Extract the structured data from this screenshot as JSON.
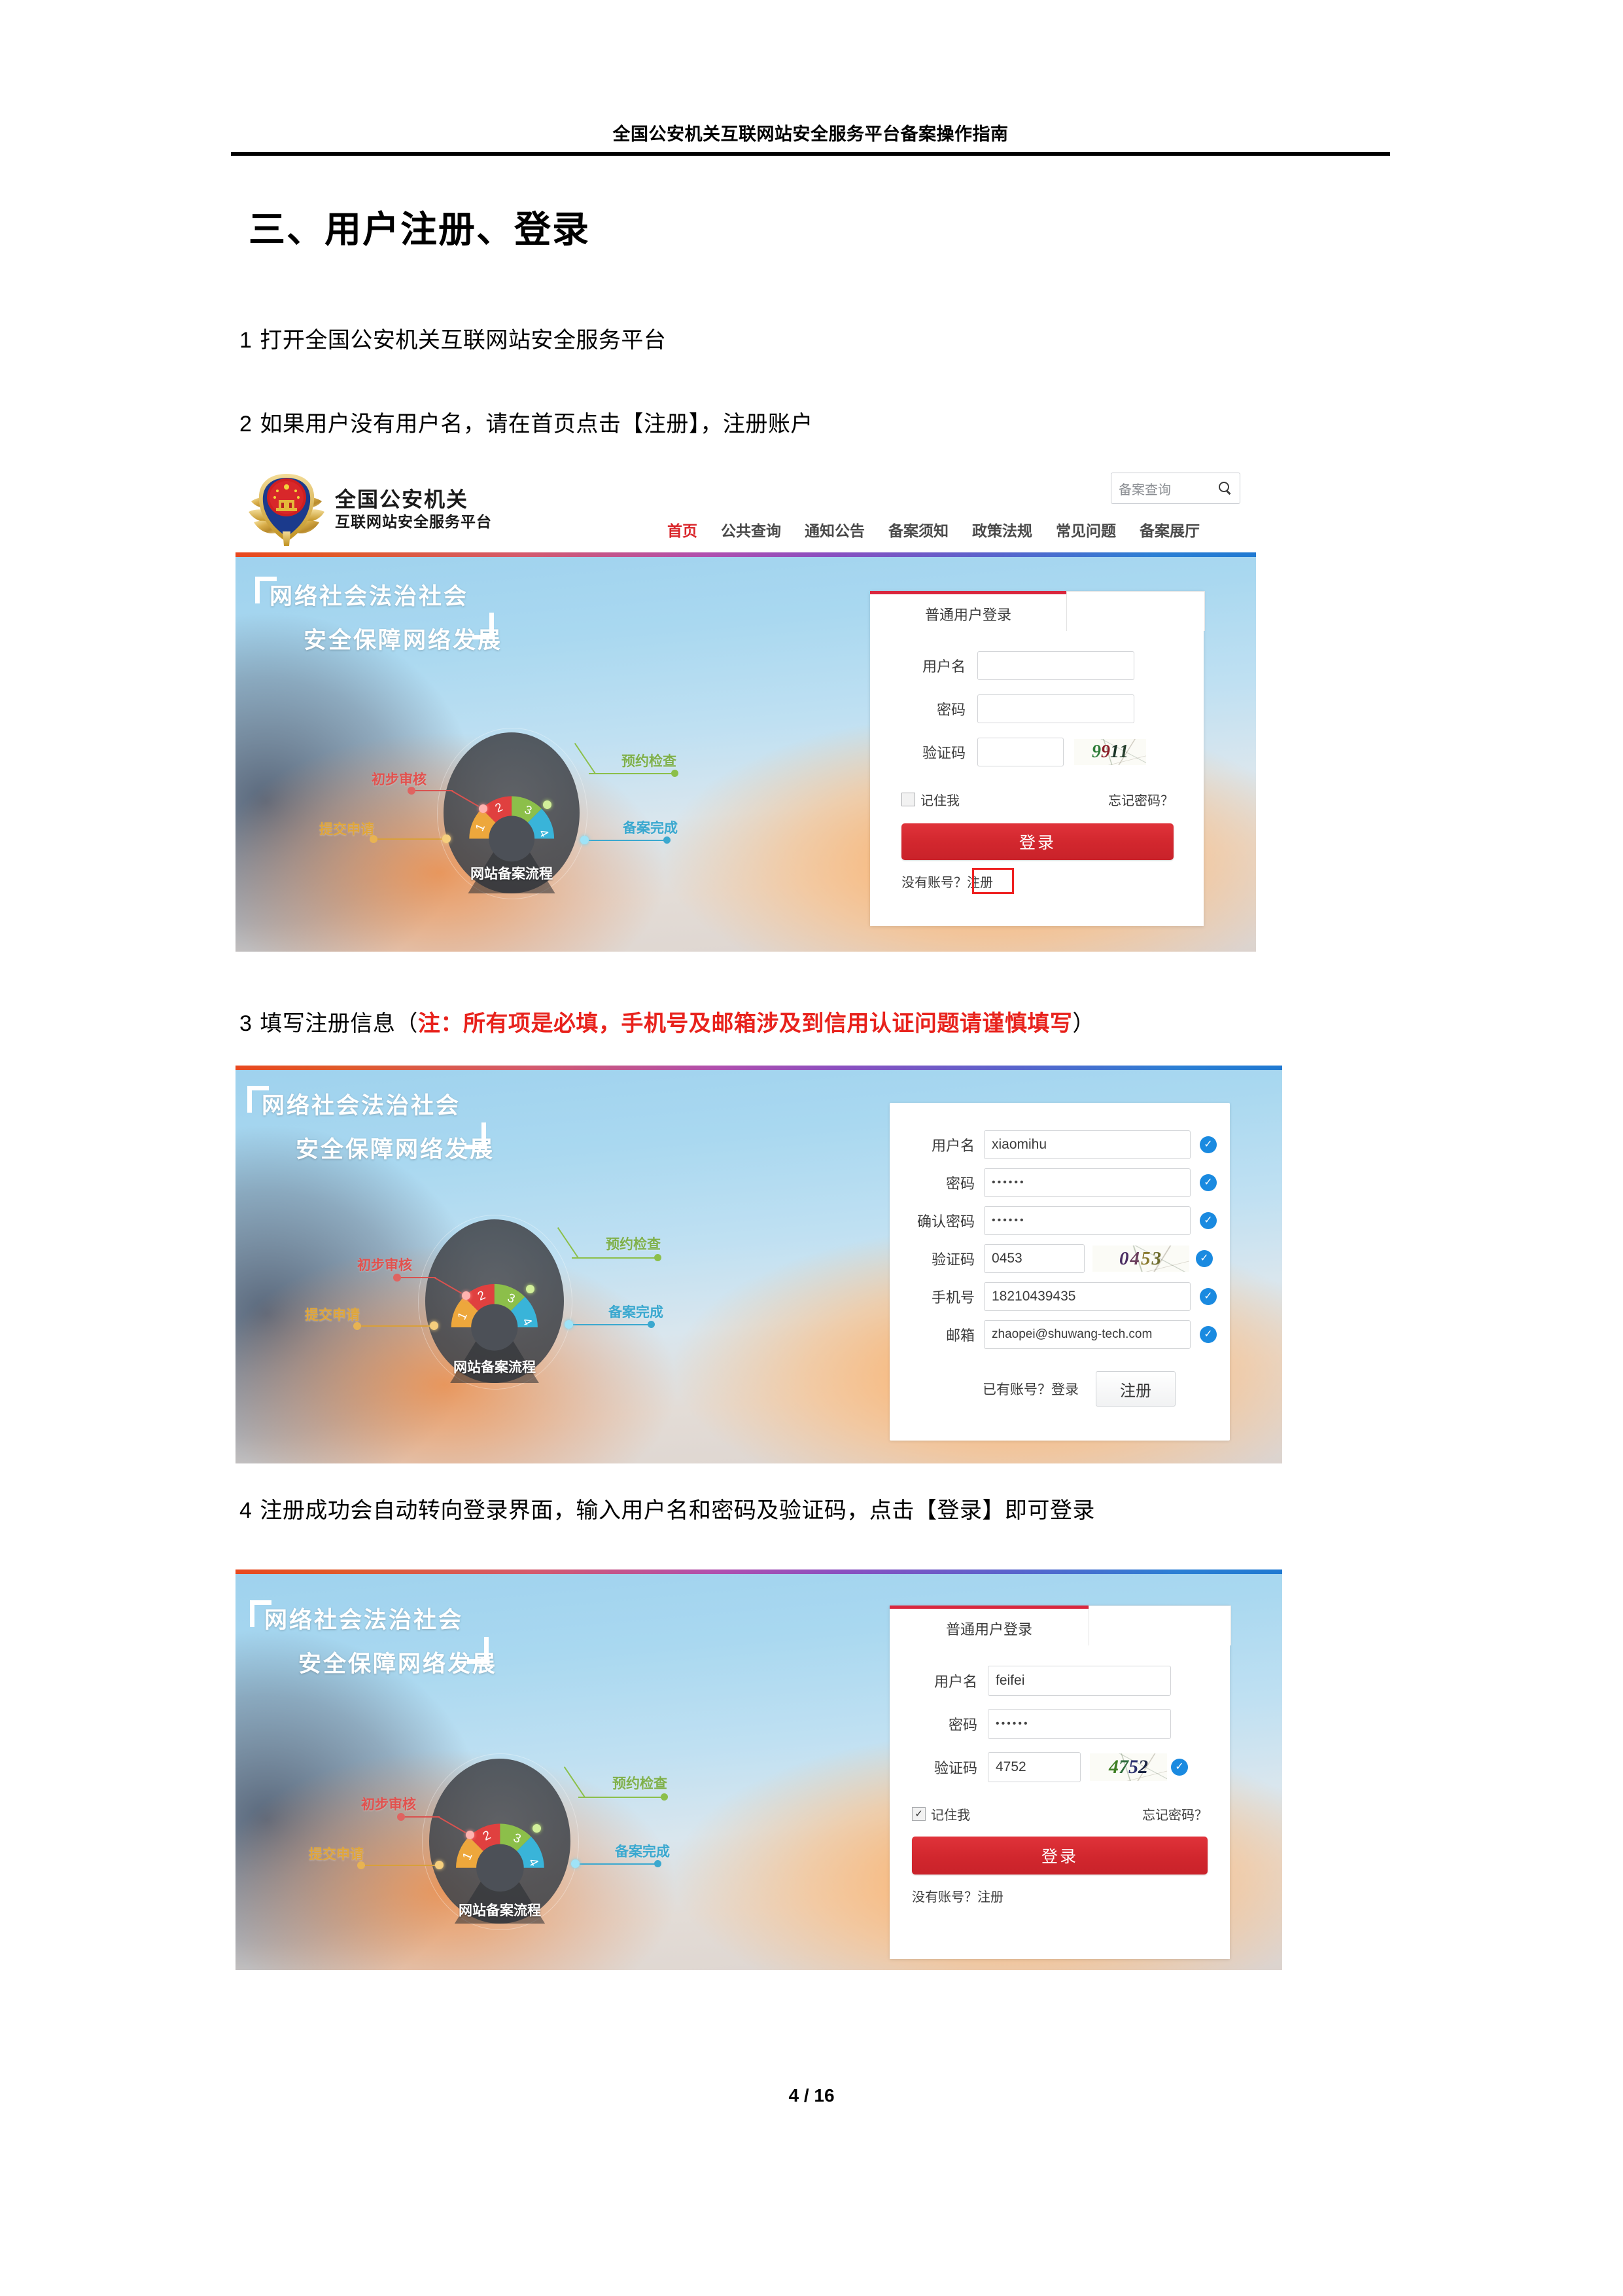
{
  "document": {
    "running_header": "全国公安机关互联网站安全服务平台备案操作指南",
    "section_title": "三、用户注册、登录",
    "footer": "4 / 16"
  },
  "steps": [
    {
      "num": "1",
      "text": "打开全国公安机关互联网站安全服务平台"
    },
    {
      "num": "2",
      "text": "如果用户没有用户名，请在首页点击【注册】，注册账户"
    },
    {
      "num": "3",
      "text_before": "填写注册信息（",
      "text_red": "注：所有项是必填，手机号及邮箱涉及到信用认证问题请谨慎填写",
      "text_after": "）"
    },
    {
      "num": "4",
      "text": "注册成功会自动转向登录界面，输入用户名和密码及验证码，点击【登录】即可登录"
    }
  ],
  "site": {
    "emblem_icon": "police-emblem-icon",
    "brand_line1": "全国公安机关",
    "brand_line2": "互联网站安全服务平台",
    "search_placeholder": "备案查询",
    "search_icon": "search-icon",
    "nav": [
      {
        "label": "首页",
        "active": true
      },
      {
        "label": "公共查询",
        "active": false
      },
      {
        "label": "通知公告",
        "active": false
      },
      {
        "label": "备案须知",
        "active": false
      },
      {
        "label": "政策法规",
        "active": false
      },
      {
        "label": "常见问题",
        "active": false
      },
      {
        "label": "备案展厅",
        "active": false
      }
    ]
  },
  "hero": {
    "slogan_line1": "网络社会法治社会",
    "slogan_line2": "安全保障网络发展",
    "wheel_title": "网站备案流程",
    "callouts": [
      {
        "label": "提交申请",
        "step": "1",
        "color": "#e6a13c"
      },
      {
        "label": "初步审核",
        "step": "2",
        "color": "#e0403f"
      },
      {
        "label": "预约检查",
        "step": "3",
        "color": "#8cbf4a"
      },
      {
        "label": "备案完成",
        "step": "4",
        "color": "#39b4d9"
      }
    ]
  },
  "login_panel_1": {
    "tab_label": "普通用户登录",
    "fields": [
      {
        "label": "用户名",
        "value": ""
      },
      {
        "label": "密码",
        "value": ""
      },
      {
        "label": "验证码",
        "value": ""
      }
    ],
    "captcha_text": "9911",
    "remember_label": "记住我",
    "remember_checked": false,
    "forgot_label": "忘记密码？",
    "login_button": "登录",
    "no_account_prefix": "没有账号？",
    "register_link": "注册"
  },
  "register_panel": {
    "fields": [
      {
        "label": "用户名",
        "value": "xiaomihu",
        "masked": false,
        "valid": true
      },
      {
        "label": "密码",
        "value": "••••••",
        "masked": true,
        "valid": true
      },
      {
        "label": "确认密码",
        "value": "••••••",
        "masked": true,
        "valid": true
      },
      {
        "label": "验证码",
        "value": "0453",
        "masked": false,
        "valid": true
      },
      {
        "label": "手机号",
        "value": "18210439435",
        "masked": false,
        "valid": true
      },
      {
        "label": "邮箱",
        "value": "zhaopei@shuwang-tech.com",
        "masked": false,
        "valid": true
      }
    ],
    "captcha_text": "0453",
    "have_account_label": "已有账号？登录",
    "register_button": "注册"
  },
  "login_panel_2": {
    "tab_label": "普通用户登录",
    "fields": [
      {
        "label": "用户名",
        "value": "feifei"
      },
      {
        "label": "密码",
        "value": "••••••"
      },
      {
        "label": "验证码",
        "value": "4752"
      }
    ],
    "captcha_text": "4752",
    "captcha_valid": true,
    "remember_label": "记住我",
    "remember_checked": true,
    "forgot_label": "忘记密码？",
    "login_button": "登录",
    "no_account_prefix": "没有账号？",
    "register_link": "注册"
  },
  "colors": {
    "accent_red": "#d2272e",
    "link_red": "#d9252a",
    "valid_blue": "#1a8ae0",
    "highlight_red": "#ee2222"
  }
}
